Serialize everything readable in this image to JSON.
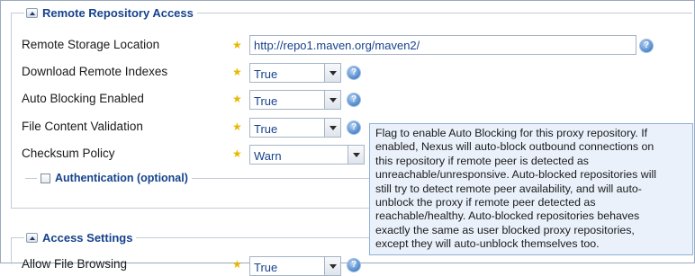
{
  "sections": {
    "remote_access": {
      "title": "Remote Repository Access"
    },
    "authentication": {
      "title": "Authentication (optional)"
    },
    "access_settings": {
      "title": "Access Settings"
    }
  },
  "fields": {
    "remote_storage": {
      "label": "Remote Storage Location",
      "value": "http://repo1.maven.org/maven2/"
    },
    "download_indexes": {
      "label": "Download Remote Indexes",
      "value": "True"
    },
    "auto_blocking": {
      "label": "Auto Blocking Enabled",
      "value": "True"
    },
    "file_validation": {
      "label": "File Content Validation",
      "value": "True"
    },
    "checksum_policy": {
      "label": "Checksum Policy",
      "value": "Warn"
    },
    "allow_browsing": {
      "label": "Allow File Browsing",
      "value": "True"
    }
  },
  "tooltip": {
    "lines": [
      "Flag to enable Auto Blocking for this proxy repository. If",
      "enabled, Nexus will auto-block outbound connections on",
      "this repository if remote peer is detected as",
      "unreachable/unresponsive. Auto-blocked repositories will",
      "still try to detect remote peer availability, and will auto-",
      "unblock the proxy if remote peer detected as",
      "reachable/healthy. Auto-blocked repositories behaves",
      "exactly the same as user blocked proxy repositories,",
      "except they will auto-unblock themselves too."
    ]
  },
  "icons": {
    "required": "star-icon",
    "help": "help-icon"
  },
  "colors": {
    "accent": "#15428b",
    "tooltip_bg": "#eaf1fb",
    "star": "#e8b800"
  }
}
